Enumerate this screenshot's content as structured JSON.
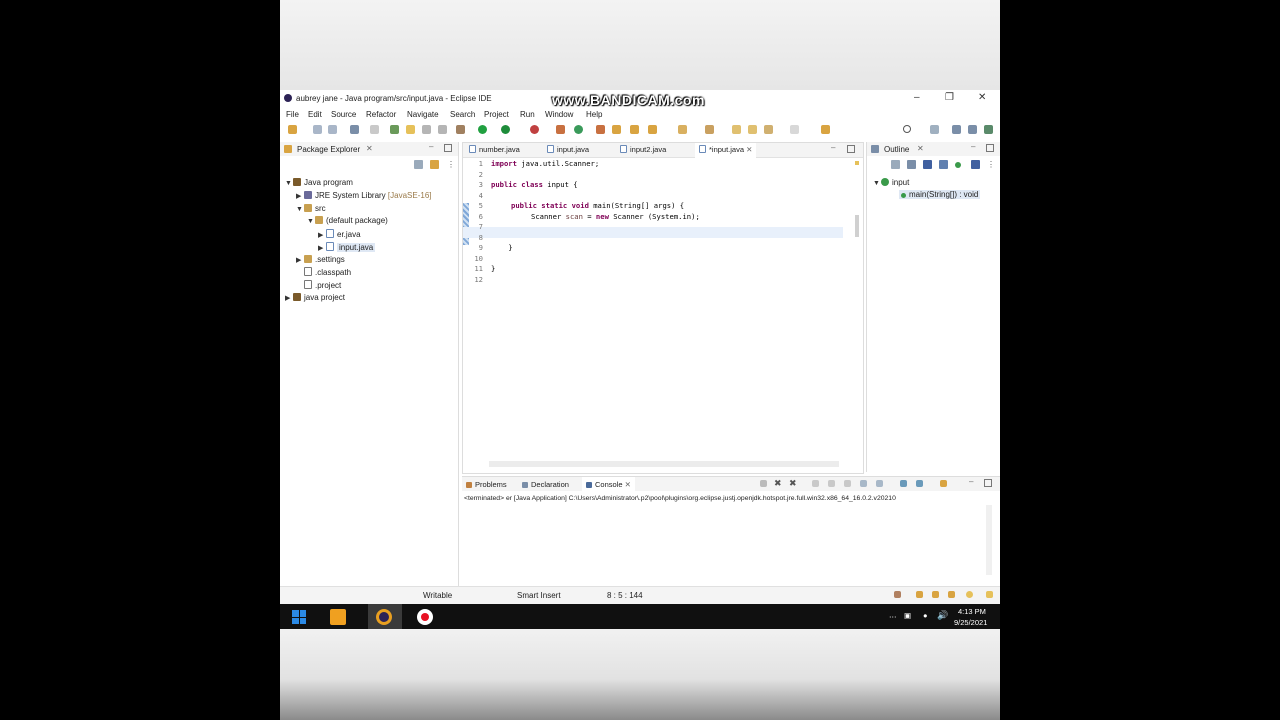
{
  "window": {
    "title": "aubrey jane - Java program/src/input.java - Eclipse IDE",
    "watermark": "www.BANDICAM.com",
    "controls": [
      "–",
      "❐",
      "✕"
    ]
  },
  "menu": [
    "File",
    "Edit",
    "Source",
    "Refactor",
    "Navigate",
    "Search",
    "Project",
    "Run",
    "Window",
    "Help"
  ],
  "package_explorer": {
    "title": "Package Explorer",
    "items": [
      {
        "label": "Java program",
        "suffix": ""
      },
      {
        "label": "JRE System Library",
        "suffix": "[JavaSE-16]"
      },
      {
        "label": "src",
        "suffix": ""
      },
      {
        "label": "(default package)",
        "suffix": ""
      },
      {
        "label": "er.java",
        "suffix": ""
      },
      {
        "label": "input.java",
        "suffix": ""
      },
      {
        "label": ".settings",
        "suffix": ""
      },
      {
        "label": ".classpath",
        "suffix": ""
      },
      {
        "label": ".project",
        "suffix": ""
      },
      {
        "label": "java project",
        "suffix": ""
      }
    ]
  },
  "editor": {
    "tabs": [
      "number.java",
      "input.java",
      "input2.java",
      "*input.java"
    ],
    "lines": [
      {
        "n": "1",
        "text": ""
      },
      {
        "n": "2",
        "text": ""
      },
      {
        "n": "3",
        "text": ""
      },
      {
        "n": "4",
        "text": ""
      },
      {
        "n": "5",
        "text": ""
      },
      {
        "n": "6",
        "text": ""
      },
      {
        "n": "7",
        "text": ""
      },
      {
        "n": "8",
        "text": ""
      },
      {
        "n": "9",
        "text": "    }"
      },
      {
        "n": "10",
        "text": ""
      },
      {
        "n": "11",
        "text": "}"
      },
      {
        "n": "12",
        "text": ""
      }
    ],
    "code": {
      "import_kw": "import",
      "import_rest": " java.util.Scanner;",
      "class_kw": "public class",
      "class_rest": " input {",
      "main_kw": "public static void",
      "main_rest": " main(String[] args) {",
      "scan_type": "Scanner ",
      "scan_var": "scan",
      "scan_eq": " = ",
      "scan_new": "new",
      "scan_rest": " Scanner (System.in);"
    }
  },
  "outline": {
    "title": "Outline",
    "items": [
      "input",
      "main(String[]) : void"
    ]
  },
  "bottom_panel": {
    "tabs": [
      "Problems",
      "Declaration",
      "Console"
    ],
    "console_text": "<terminated> er [Java Application] C:\\Users\\Administrator\\.p2\\pool\\plugins\\org.eclipse.justj.openjdk.hotspot.jre.full.win32.x86_64_16.0.2.v20210"
  },
  "status_bar": {
    "writable": "Writable",
    "insert_mode": "Smart Insert",
    "position": "8 : 5 : 144"
  },
  "taskbar": {
    "time": "4:13 PM",
    "date": "9/25/2021"
  },
  "colors": {
    "accent": "#2b579a",
    "keyword": "#7f0055",
    "record": "#e81123"
  }
}
